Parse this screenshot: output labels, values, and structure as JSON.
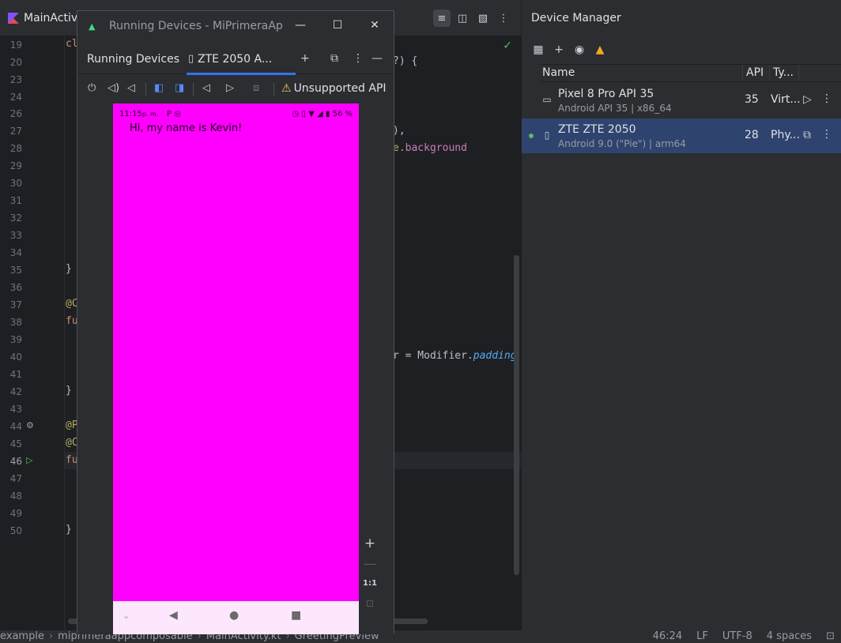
{
  "editor": {
    "file_tab": "MainActivi",
    "line_numbers": [
      "19",
      "20",
      "23",
      "24",
      "26",
      "27",
      "28",
      "29",
      "30",
      "31",
      "32",
      "33",
      "34",
      "35",
      "36",
      "37",
      "38",
      "39",
      "40",
      "41",
      "42",
      "43",
      "44",
      "45",
      "46",
      "47",
      "48",
      "49",
      "50"
    ],
    "code_fragments": {
      "l19": "cl",
      "l19b": "?) {",
      "l27": "),",
      "l28a": "e.",
      "l28b": "background",
      "l35": "}",
      "l37": "@C",
      "l38": "fu",
      "l40a": "r = Modifier.",
      "l40b": "padding",
      "l42": "}",
      "l44": "@P",
      "l45": "@C",
      "l46": "fu",
      "l50": "}"
    }
  },
  "running_devices": {
    "window_title": "Running Devices - MiPrimeraApp(",
    "tool_title": "Running Devices",
    "device_tab": "ZTE 2050 A...",
    "unsupported_label": "Unsupported API",
    "zoom_one_to_one": "1:1"
  },
  "phone": {
    "time": "11:15",
    "time_suffix": "p. m.",
    "battery": "56 %",
    "greeting": "Hi, my name is Kevin!",
    "background": "#ff00ff"
  },
  "device_manager": {
    "title": "Device Manager",
    "columns": {
      "name": "Name",
      "api": "API",
      "type": "Ty..."
    },
    "devices": [
      {
        "name": "Pixel 8 Pro API 35",
        "details": "Android API 35 | x86_64",
        "api": "35",
        "type": "Virt..."
      },
      {
        "name": "ZTE ZTE 2050",
        "details": "Android 9.0 (\"Pie\") | arm64",
        "api": "28",
        "type": "Phy..."
      }
    ]
  },
  "status_bar": {
    "breadcrumb": [
      "example",
      "miprimeraappcomposable",
      "MainActivity.kt",
      "GreetingPreview"
    ],
    "position": "46:24",
    "line_ending": "LF",
    "encoding": "UTF-8",
    "indent": "4 spaces"
  }
}
